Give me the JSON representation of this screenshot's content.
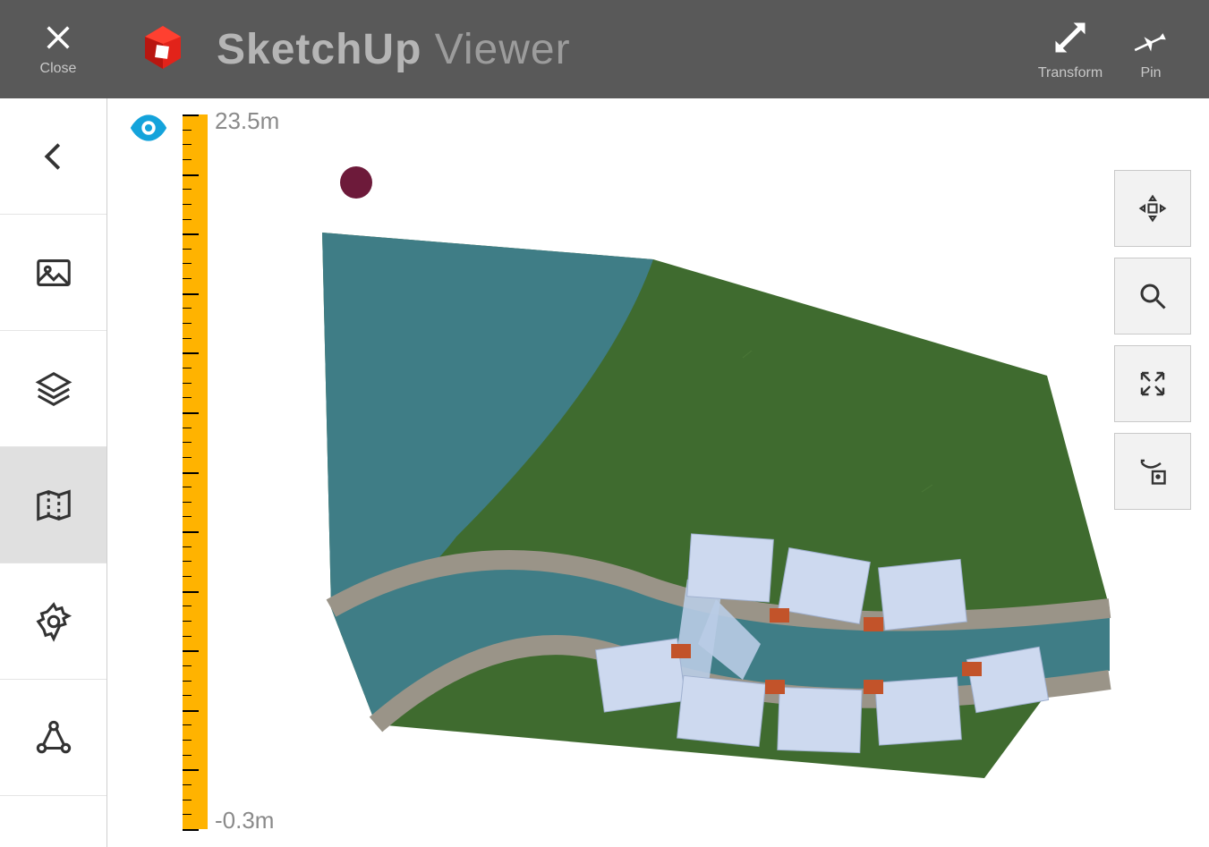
{
  "header": {
    "close_label": "Close",
    "title_bold": "SketchUp",
    "title_light": "Viewer",
    "transform_label": "Transform",
    "pin_label": "Pin"
  },
  "sidebar": {
    "back_icon": "chevron-left",
    "items": [
      "images",
      "layers",
      "map",
      "settings",
      "share"
    ],
    "active_index": 2
  },
  "ruler": {
    "top": "23.5m",
    "bottom": "-0.3m"
  },
  "right_tools": {
    "items": [
      "move",
      "search",
      "fullscreen",
      "scene"
    ]
  },
  "visibility": {
    "state": "visible"
  },
  "marker": {
    "color": "#6d1a3a"
  }
}
